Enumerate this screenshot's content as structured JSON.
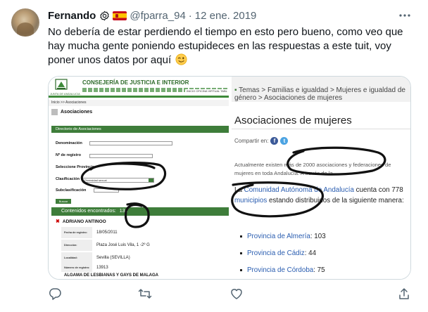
{
  "tweet": {
    "name": "Fernando",
    "handle": "@fparra_94",
    "dot": "·",
    "date": "12 ene. 2019",
    "text": "No debería de estar perdiendo el tiempo en esto pero bueno, como veo que hay mucha gente poniendo estupideces en las respuestas a este tuit, voy poner unos datos por aquí",
    "emoji_icon": "winking-face-icon"
  },
  "left_shot": {
    "logo_text": "JUNTA DE ANDALUCIA",
    "header_title": "CONSEJERÍA DE JUSTICIA E INTERIOR",
    "header_link": "INICIO  OFICINA VIRTUAL  TABL",
    "breadcrumb": "Inicio >> Asociaciones",
    "heading": "Asociaciones",
    "bar_title": "Directorio de Asociaciones",
    "label_denominacion": "Denominación",
    "label_registro": "Nº de registro",
    "label_provincia": "Seleccione Provincia",
    "label_clasificacion": "Clasificación",
    "select_clasificacion": "Diversidad sexual",
    "label_subclasificacion": "Subclasificación",
    "button_buscar": "Buscar",
    "found_label": "Contenidos encontrados:",
    "found_count": "131",
    "entry_name": "ADRIANO ANTINOO",
    "rows": [
      {
        "key": "Fecha de registro:",
        "value": "18/05/2011"
      },
      {
        "key": "Dirección:",
        "value": "Plaza José Luis Vila, 1 -2º G"
      },
      {
        "key": "Localidad:",
        "value": "Sevilla (SEVILLA)"
      },
      {
        "key": "Número de registro:",
        "value": "13913"
      }
    ],
    "footer_entry": "ALGAMA DE LESBIANAS Y GAYS DE MALAGA"
  },
  "right_shot": {
    "breadcrumb_prefix": "Temas > Familias e igualdad > Mujeres e igualdad de género > Asociaciones de mujeres",
    "title": "Asociaciones de mujeres",
    "share_label": "Compartir en:",
    "para1": "Actualmente existen más de 2000 asociaciones y federaciones de mujeres en toda Andalucía. A través de la",
    "para2_a": "La ",
    "para2_link1": "Comunidad Autónoma de Andalucía",
    "para2_b": " cuenta con 778 ",
    "para2_link2": "municipios",
    "para2_c": " estando distribuidos de la siguiente manera:",
    "list": [
      {
        "prov": "Provincia de Almería",
        "count": ": 103"
      },
      {
        "prov": "Provincia de Cádiz",
        "count": ": 44"
      },
      {
        "prov": "Provincia de Córdoba",
        "count": ": 75"
      }
    ]
  },
  "colors": {
    "junta_green": "#3e7d3a",
    "link_blue": "#2a5db0",
    "muted": "#536471"
  }
}
